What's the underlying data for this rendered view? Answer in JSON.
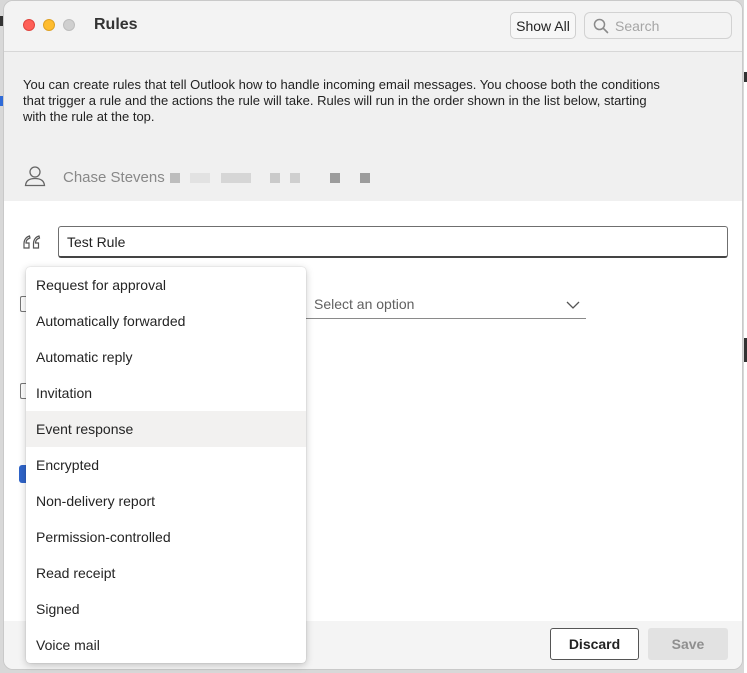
{
  "window": {
    "title": "Rules",
    "show_all_label": "Show All",
    "search_placeholder": "Search"
  },
  "description": "You can create rules that tell Outlook how to handle incoming email messages. You choose both the conditions that trigger a rule and the actions the rule will take. Rules will run in the order shown in the list below, starting with the rule at the top.",
  "account": {
    "name": "Chase Stevens"
  },
  "rule": {
    "name_value": "Test Rule"
  },
  "select": {
    "placeholder": "Select an option"
  },
  "dropdown": {
    "items": [
      "Request for approval",
      "Automatically forwarded",
      "Automatic reply",
      "Invitation",
      "Event response",
      "Encrypted",
      "Non-delivery report",
      "Permission-controlled",
      "Read receipt",
      "Signed",
      "Voice mail"
    ],
    "hovered_item": "Event response"
  },
  "footer": {
    "discard_label": "Discard",
    "save_label": "Save"
  },
  "colors": {
    "accent": "#2f64c9",
    "close": "#fe5f57",
    "minimize": "#febc2e"
  }
}
